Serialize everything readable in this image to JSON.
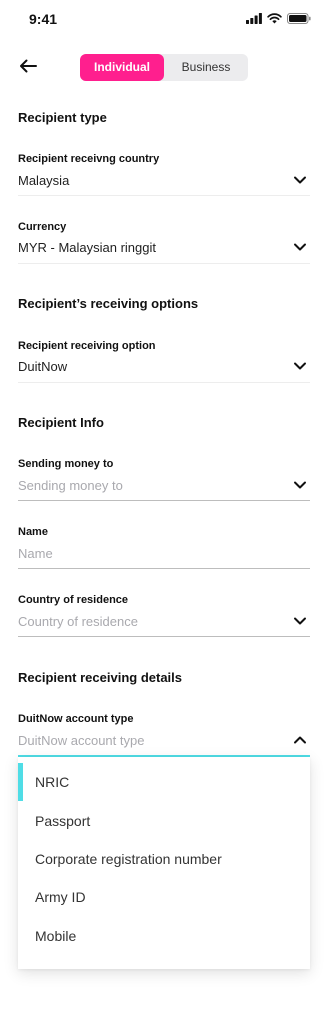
{
  "status_bar": {
    "time": "9:41",
    "icons": [
      "cellular-signal-icon",
      "wifi-icon",
      "battery-icon"
    ]
  },
  "header": {
    "back_icon": "arrow-left-icon",
    "segments": [
      {
        "label": "Individual",
        "selected": true
      },
      {
        "label": "Business",
        "selected": false
      }
    ]
  },
  "colors": {
    "accent_pink": "#ff1f8e",
    "accent_cyan": "#4fdde6"
  },
  "sections": {
    "recipient_type": "Recipient type",
    "receiving_options": "Recipient’s receiving options",
    "recipient_info": "Recipient Info",
    "receiving_details": "Recipient receiving details"
  },
  "fields": {
    "country": {
      "label": "Recipient receivng country",
      "value": "Malaysia"
    },
    "currency": {
      "label": "Currency",
      "value": "MYR - Malaysian ringgit"
    },
    "receiving_option": {
      "label": "Recipient receiving option",
      "value": "DuitNow"
    },
    "sending_to": {
      "label": "Sending money to",
      "placeholder": "Sending money to"
    },
    "name": {
      "label": "Name",
      "placeholder": "Name"
    },
    "residence": {
      "label": "Country of residence",
      "placeholder": "Country of residence"
    },
    "account_type": {
      "label": "DuitNow account type",
      "placeholder": "DuitNow account type"
    }
  },
  "dropdown": {
    "options": [
      "NRIC",
      "Passport",
      "Corporate registration number",
      "Army ID",
      "Mobile"
    ],
    "highlighted_index": 0
  }
}
